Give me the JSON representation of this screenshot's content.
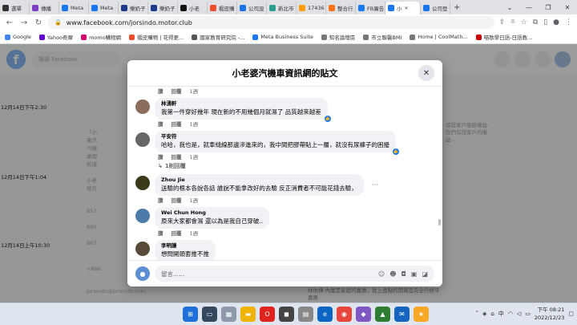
{
  "browser": {
    "tabs": [
      {
        "label": "選單",
        "color": "#333333"
      },
      {
        "label": "傳播",
        "color": "#7b3fbf"
      },
      {
        "label": "Meta",
        "color": "#1877f2"
      },
      {
        "label": "Meta",
        "color": "#1877f2"
      },
      {
        "label": "樂奶子",
        "color": "#1e3a8a"
      },
      {
        "label": "樂奶子",
        "color": "#1e3a8a"
      },
      {
        "label": "小老",
        "color": "#111111"
      },
      {
        "label": "蝦皮購",
        "color": "#ee4d2d"
      },
      {
        "label": "公司設",
        "color": "#1a73e8"
      },
      {
        "label": "新北市",
        "color": "#2a9d8f"
      },
      {
        "label": "17436",
        "color": "#ffa000"
      },
      {
        "label": "整合行",
        "color": "#f97316"
      },
      {
        "label": "FB廣告",
        "color": "#1877f2"
      },
      {
        "label": "小",
        "color": "#1877f2",
        "active": true
      },
      {
        "label": "公司登",
        "color": "#1a73e8"
      }
    ],
    "new_tab": "+",
    "url": "www.facebook.com/jorsindo.motor.club",
    "bookmarks": [
      {
        "label": "Google",
        "color": "#4285f4"
      },
      {
        "label": "Yahoo奇摩",
        "color": "#6001d2"
      },
      {
        "label": "momo購物網",
        "color": "#d6006f"
      },
      {
        "label": "蝦皮購物 | 花得更...",
        "color": "#ee4d2d"
      },
      {
        "label": "國家教育研究院 -...",
        "color": "#555555"
      },
      {
        "label": "Meta Business Suite",
        "color": "#1877f2"
      },
      {
        "label": "知名論壇區",
        "color": "#777777"
      },
      {
        "label": "市立聯醫BMI",
        "color": "#777777"
      },
      {
        "label": "Home | CoolMath...",
        "color": "#777777"
      },
      {
        "label": "喵歌學日語-日語教...",
        "color": "#cc0000"
      }
    ]
  },
  "facebook": {
    "search_placeholder": "搜尋 Facebook",
    "timestamps": [
      "12月14日下午2:30",
      "12月14日下午1:04",
      "12月14日上午10:30"
    ],
    "bg_post_texts": [
      "「小",
      "果汽",
      "汽機",
      "處理",
      "知道",
      "小老",
      "地方"
    ],
    "bg_numbers": [
      "657",
      "660",
      "667",
      "+886",
      "jorsindo@jorsindo.com"
    ],
    "bg_right": "保證客戶服務權益-我們保證客戶的權益...",
    "bg_bottom_name": "林依樺 ...",
    "bg_bottom_right": "林依樺 內層是家庭的嘉惠，從上面點的開報是完全行修平嘉惠"
  },
  "modal": {
    "title": "小老婆汽機車資訊網的貼文",
    "actions": {
      "like": "讚",
      "reply": "回覆",
      "time": "1週"
    },
    "reply_count": "1則回覆",
    "comments": [
      {
        "name": "林湧軒",
        "text": "我第一件穿好幾年 現在新的不用幾個月就濕了 品質越來越差",
        "avatar_color": "#8a6d5a",
        "liked": true
      },
      {
        "name": "平安符",
        "text": "哈哈，我也是，就車縫線那邊滲進來的，我中間把膠帶貼上一層，就沒有尿褲子的困擾",
        "avatar_color": "#666666",
        "liked": true
      },
      {
        "name": "Zhou Jie",
        "text": "送驗的根本各說各話 誰說不能拿改好的去驗 反正消費者不可能花錢去驗，",
        "avatar_color": "#3a3a1a",
        "liked": false
      },
      {
        "name": "Wei Chun Hong",
        "text": "原來大家都會濕 還以為是我自己穿破..",
        "avatar_color": "#4d7aa8",
        "liked": false
      },
      {
        "name": "李明謙",
        "text": "想問開頭套推不推",
        "avatar_color": "#5a4a3a",
        "liked": false
      }
    ],
    "composer": {
      "placeholder": "留言......"
    }
  },
  "taskbar": {
    "time": "下午 08:21",
    "date": "2022/12/23",
    "lang": "中"
  }
}
